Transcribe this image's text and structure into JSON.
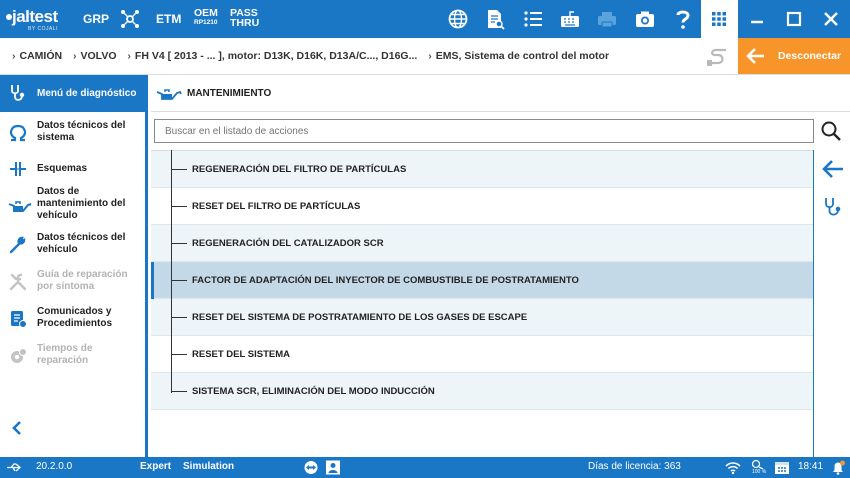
{
  "topbar": {
    "logo_text": "jaltest",
    "logo_sub": "BY COJALI",
    "grp": "GRP",
    "etm": "ETM",
    "oem_top": "OEM",
    "oem_bottom": "RP1210",
    "pass_top": "PASS",
    "pass_bottom": "THRU",
    "icons": [
      "network-icon",
      "document-search-icon",
      "list-icon",
      "keyboard-icon",
      "printer-icon",
      "camera-icon",
      "help-icon",
      "grid-icon",
      "minimize-icon",
      "maximize-icon",
      "close-icon"
    ]
  },
  "breadcrumb": {
    "items": [
      "CAMIÓN",
      "VOLVO",
      "FH V4 [ 2013 - ... ], motor: D13K, D16K, D13A/C..., D16G...",
      "EMS, Sistema de control del motor"
    ]
  },
  "disconnect": {
    "label": "Desconectar"
  },
  "sidebar": {
    "header": "Menú de diagnóstico",
    "items": [
      {
        "label": "Datos técnicos del sistema",
        "icon": "omega-icon",
        "enabled": true
      },
      {
        "label": "Esquemas",
        "icon": "schematic-icon",
        "enabled": true
      },
      {
        "label": "Datos de mantenimiento del vehículo",
        "icon": "oil-can-icon",
        "enabled": true
      },
      {
        "label": "Datos técnicos del vehículo",
        "icon": "wrench-icon",
        "enabled": true
      },
      {
        "label": "Guía de reparación por síntoma",
        "icon": "tools-icon",
        "enabled": false
      },
      {
        "label": "Comunicados y Procedimientos",
        "icon": "bulletin-icon",
        "enabled": true
      },
      {
        "label": "Tiempos de reparación",
        "icon": "gear-clock-icon",
        "enabled": false
      }
    ]
  },
  "content": {
    "title": "MANTENIMIENTO",
    "search_placeholder": "Buscar en el listado de acciones",
    "rows": [
      "REGENERACIÓN DEL FILTRO DE PARTÍCULAS",
      "RESET DEL FILTRO DE PARTÍCULAS",
      "REGENERACIÓN DEL CATALIZADOR SCR",
      "FACTOR DE ADAPTACIÓN DEL INYECTOR DE COMBUSTIBLE DE POSTRATAMIENTO",
      "RESET DEL SISTEMA DE POSTRATAMIENTO DE LOS GASES DE ESCAPE",
      "RESET DEL SISTEMA",
      "SISTEMA SCR, ELIMINACIÓN DEL MODO INDUCCIÓN"
    ],
    "selected_index": 3
  },
  "statusbar": {
    "version": "20.2.0.0",
    "mode": "Expert",
    "simulation": "Simulation",
    "license": "Días de licencia: 363",
    "battery": "100 %",
    "time": "18:41"
  },
  "colors": {
    "primary": "#1a77c5",
    "accent": "#f7942a",
    "selected_row": "#c4d9e8"
  }
}
